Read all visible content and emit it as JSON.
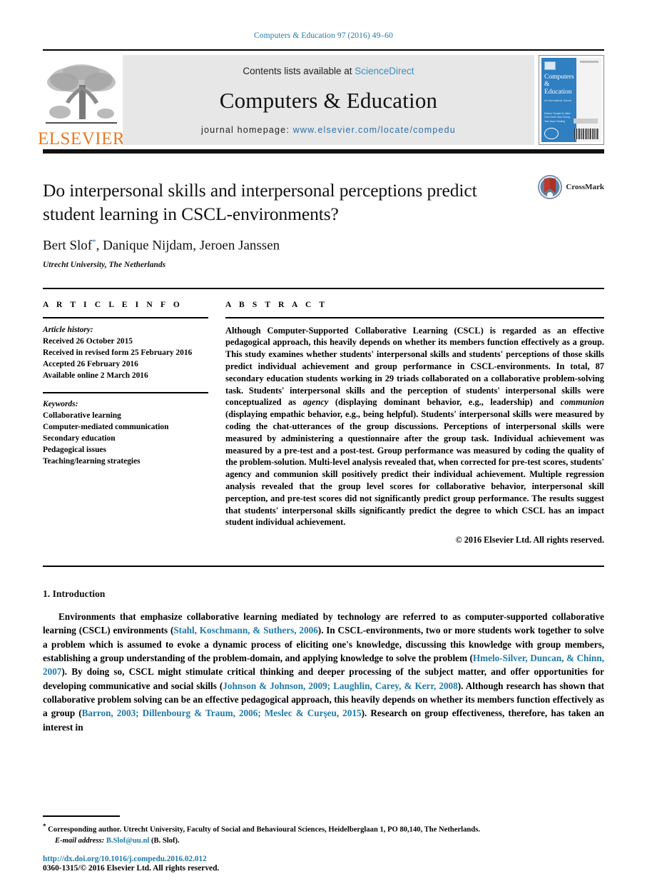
{
  "running_head": "Computers & Education 97 (2016) 49–60",
  "masthead": {
    "contents_prefix": "Contents lists available at",
    "sciencedirect": "ScienceDirect",
    "journal_name": "Computers & Education",
    "homepage_prefix": "journal homepage:",
    "homepage_url": "www.elsevier.com/locate/compedu",
    "publisher_wordmark": "ELSEVIER",
    "cover": {
      "title_line1": "Computers",
      "title_line2": "&",
      "title_line3": "Education",
      "subtitle": "An International Journal",
      "editors": "Editors:\nRonald M. Aiken\nChris Dede\nWan-Chung Tsai\nJason Yeading",
      "seal_text": "ELSEVIER"
    },
    "link_color": "#3a8fc4",
    "brand_orange": "#E87722"
  },
  "article": {
    "title": "Do interpersonal skills and interpersonal perceptions predict student learning in CSCL-environments?",
    "authors": "Bert Slof",
    "authors_rest": ", Danique Nijdam, Jeroen Janssen",
    "author_marker": "*",
    "affiliation": "Utrecht University, The Netherlands",
    "crossmark_label": "CrossMark"
  },
  "info": {
    "heading": "A R T I C L E   I N F O",
    "history_label": "Article history:",
    "history": [
      "Received 26 October 2015",
      "Received in revised form 25 February 2016",
      "Accepted 26 February 2016",
      "Available online 2 March 2016"
    ],
    "keywords_label": "Keywords:",
    "keywords": [
      "Collaborative learning",
      "Computer-mediated communication",
      "Secondary education",
      "Pedagogical issues",
      "Teaching/learning strategies"
    ]
  },
  "abstract": {
    "heading": "A B S T R A C T",
    "p1": "Although Computer-Supported Collaborative Learning (CSCL) is regarded as an effective pedagogical approach, this heavily depends on whether its members function effectively as a group. This study examines whether students' interpersonal skills and students' perceptions of those skills predict individual achievement and group performance in CSCL-environments. In total, 87 secondary education students working in 29 triads collaborated on a collaborative problem-solving task. Students' interpersonal skills and the perception of students' interpersonal skills were conceptualized as ",
    "em1": "agency",
    "p2": " (displaying dominant behavior, e.g., leadership) and ",
    "em2": "communion",
    "p3": " (displaying empathic behavior, e.g., being helpful). Students' interpersonal skills were measured by coding the chat-utterances of the group discussions. Perceptions of interpersonal skills were measured by administering a questionnaire after the group task. Individual achievement was measured by a pre-test and a post-test. Group performance was measured by coding the quality of the problem-solution. Multi-level analysis revealed that, when corrected for pre-test scores, students' agency and communion skill positively predict their individual achievement. Multiple regression analysis revealed that the group level scores for collaborative behavior, interpersonal skill perception, and pre-test scores did not significantly predict group performance. The results suggest that students' interpersonal skills significantly predict the degree to which CSCL has an impact student individual achievement.",
    "copyright": "© 2016 Elsevier Ltd. All rights reserved."
  },
  "body": {
    "section_number_title": "1. Introduction",
    "para_1_a": "Environments that emphasize collaborative learning mediated by technology are referred to as computer-supported collaborative learning (CSCL) environments (",
    "cite_1": "Stahl, Koschmann, & Suthers, 2006",
    "para_1_b": "). In CSCL-environments, two or more students work together to solve a problem which is assumed to evoke a dynamic process of eliciting one's knowledge, discussing this knowledge with group members, establishing a group understanding of the problem-domain, and applying knowledge to solve the problem (",
    "cite_2": "Hmelo-Silver, Duncan, & Chinn, 2007",
    "para_1_c": "). By doing so, CSCL might stimulate critical thinking and deeper processing of the subject matter, and offer opportunities for developing communicative and social skills (",
    "cite_3": "Johnson & Johnson, 2009; Laughlin, Carey, & Kerr, 2008",
    "para_1_d": "). Although research has shown that collaborative problem solving can be an effective pedagogical approach, this heavily depends on whether its members function effectively as a group (",
    "cite_4": "Barron, 2003; Dillenbourg & Traum, 2006; Meslec & Curşeu, 2015",
    "para_1_e": "). Research on group effectiveness, therefore, has taken an interest in"
  },
  "footnotes": {
    "marker": "*",
    "corresponding": " Corresponding author. Utrecht University, Faculty of Social and Behavioural Sciences, Heidelberglaan 1, PO 80,140, The Netherlands.",
    "email_label": "E-mail address:",
    "email": "B.Slof@uu.nl",
    "email_suffix": " (B. Slof).",
    "doi": "http://dx.doi.org/10.1016/j.compedu.2016.02.012",
    "issn_line": "0360-1315/© 2016 Elsevier Ltd. All rights reserved."
  }
}
